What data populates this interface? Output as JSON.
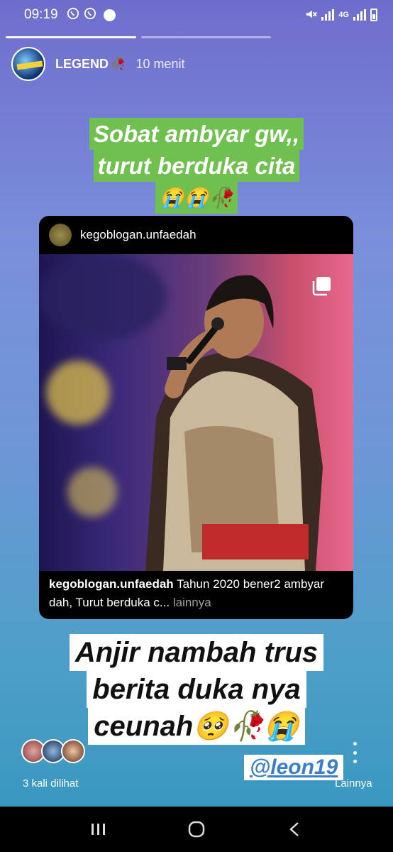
{
  "status_bar": {
    "time": "09:19",
    "network": "4G"
  },
  "story": {
    "progress_segments": [
      {
        "state": "viewed"
      },
      {
        "state": "pending"
      }
    ],
    "header": {
      "username": "LEGEND",
      "username_emoji": "🥀",
      "time_ago": "10 menit"
    },
    "caption_top": {
      "lines": [
        "Sobat ambyar gw,,",
        "turut berduka cita",
        "😭😭🥀"
      ],
      "background": "#6fc04f"
    },
    "post": {
      "author": "kegoblogan.unfaedah",
      "caption_author": "kegoblogan.unfaedah",
      "caption_text": "Tahun 2020 bener2 ambyar dah, Turut berduka c...",
      "more_label": "lainnya"
    },
    "caption_bottom": {
      "lines": [
        "Anjir nambah trus",
        "berita duka nya",
        "ceunah🥺🥀😭"
      ]
    },
    "mention": "@leon19",
    "views_text": "3 kali dilihat",
    "more_label": "Lainnya"
  }
}
